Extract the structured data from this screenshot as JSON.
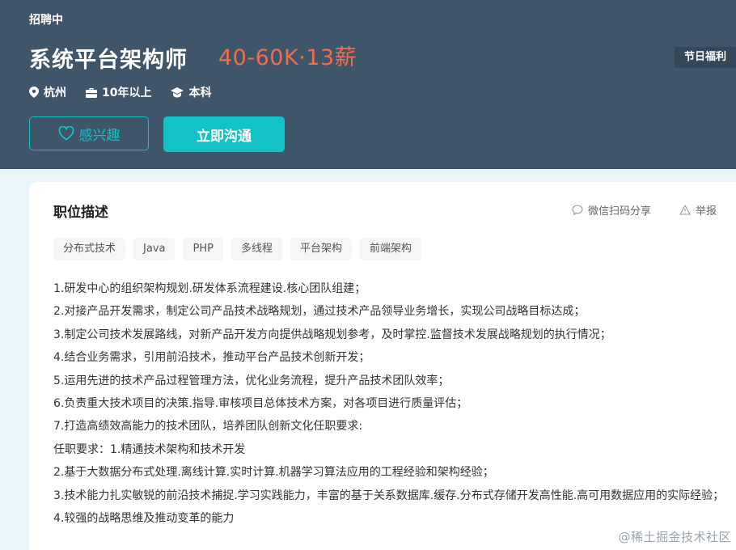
{
  "header": {
    "status": "招聘中",
    "title": "系统平台架构师",
    "salary": "40-60K·13薪",
    "welfare_badge": "节日福利",
    "meta": {
      "city": "杭州",
      "experience": "10年以上",
      "education": "本科"
    },
    "buttons": {
      "interest": "感兴趣",
      "chat": "立即沟通"
    }
  },
  "description": {
    "title": "职位描述",
    "share": "微信扫码分享",
    "report": "举报",
    "tags": [
      "分布式技术",
      "Java",
      "PHP",
      "多线程",
      "平台架构",
      "前端架构"
    ],
    "lines": [
      "1.研发中心的组织架构规划.研发体系流程建设.核心团队组建；",
      "2.对接产品开发需求，制定公司产品技术战略规划，通过技术产品领导业务增长，实现公司战略目标达成；",
      "3.制定公司技术发展路线，对新产品开发方向提供战略规划参考，及时掌控.监督技术发展战略规划的执行情况；",
      "4.结合业务需求，引用前沿技术，推动平台产品技术创新开发；",
      "5.运用先进的技术产品过程管理方法，优化业务流程，提升产品技术团队效率；",
      "6.负责重大技术项目的决策.指导.审核项目总体技术方案，对各项目进行质量评估；",
      "7.打造高绩效高能力的技术团队，培养团队创新文化任职要求:",
      "任职要求：1.精通技术架构和技术开发",
      "2.基于大数据分布式处理.离线计算.实时计算.机器学习算法应用的工程经验和架构经验；",
      "3.技术能力扎实敏锐的前沿技术捕捉.学习实践能力，丰富的基于关系数据库.缓存.分布式存储开发高性能.高可用数据应用的实际经验；",
      "4.较强的战略思维及推动变革的能力"
    ]
  },
  "watermark": "@稀土掘金技术社区",
  "colors": {
    "header_bg": "#3f5569",
    "accent": "#14c1c7",
    "salary": "#f26d4e"
  }
}
